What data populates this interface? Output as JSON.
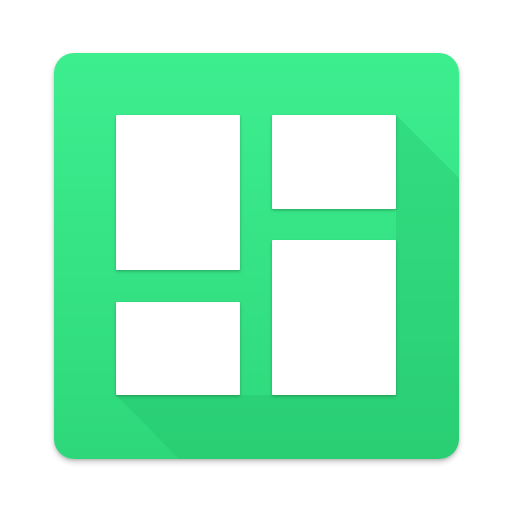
{
  "app_icon": {
    "name": "collage-grid-app-icon",
    "colors": {
      "background_top": "#3DEE8F",
      "background_bottom": "#2ED87A",
      "tile": "#FFFFFF",
      "shadow": "#22B866"
    },
    "tiles": [
      {
        "id": "top-left"
      },
      {
        "id": "top-right"
      },
      {
        "id": "bottom-left"
      },
      {
        "id": "bottom-right"
      }
    ]
  }
}
